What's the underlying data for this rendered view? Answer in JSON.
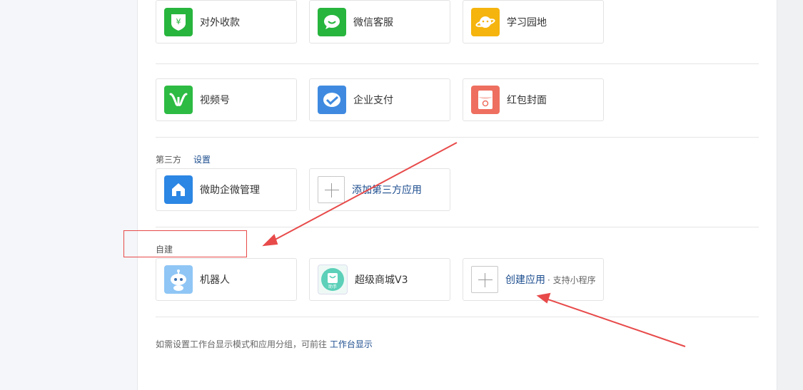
{
  "row1": [
    {
      "label": "对外收款",
      "icon": "yuan-shield-icon",
      "color": "#27b53d"
    },
    {
      "label": "微信客服",
      "icon": "chat-bubble-icon",
      "color": "#27b53d"
    },
    {
      "label": "学习园地",
      "icon": "planet-icon",
      "color": "#f5b40e"
    }
  ],
  "row2": [
    {
      "label": "视频号",
      "icon": "channels-icon",
      "color": "#2dbb43"
    },
    {
      "label": "企业支付",
      "icon": "payment-check-icon",
      "color": "#3f8ae0"
    },
    {
      "label": "红包封面",
      "icon": "red-envelope-icon",
      "color": "#ee6f5f"
    }
  ],
  "third_party": {
    "title": "第三方",
    "settings_link": "设置",
    "apps": [
      {
        "label": "微助企微管理",
        "icon": "home-icon",
        "color": "#2c86e4"
      }
    ],
    "add_label": "添加第三方应用"
  },
  "self_built": {
    "title": "自建",
    "apps": [
      {
        "label": "机器人",
        "icon": "robot-icon",
        "color": "#8fc6f5"
      },
      {
        "label": "超级商城V3",
        "icon": "shopping-bag-icon",
        "color": "#5cd0b8",
        "badge": "助手"
      }
    ],
    "create_label": "创建应用",
    "create_sub": "· 支持小程序"
  },
  "footer": {
    "text": "如需设置工作台显示模式和应用分组，可前往 ",
    "link": "工作台显示"
  },
  "colors": {
    "accent": "#1d4e8f",
    "annotation": "#e84a4a"
  }
}
